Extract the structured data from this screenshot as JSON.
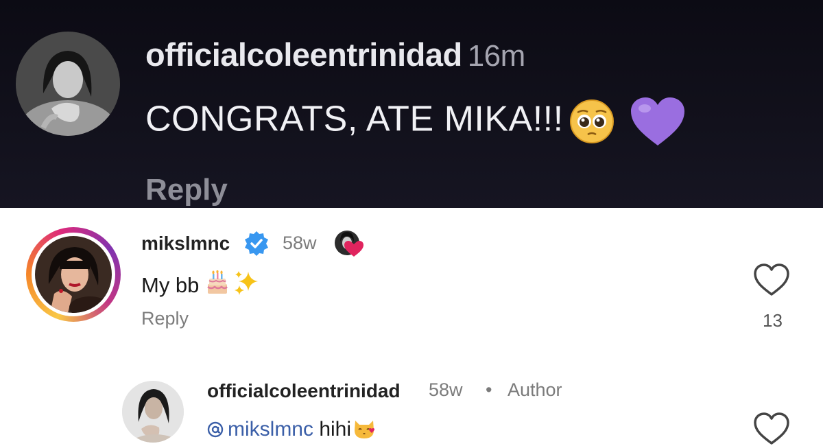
{
  "top_comment": {
    "username": "officialcoleentrinidad",
    "time": "16m",
    "text": "CONGRATS, ATE MIKA!!!",
    "emoji_1": "pleading-face-icon",
    "emoji_2": "purple-heart-icon",
    "reply_label": "Reply"
  },
  "comment": {
    "username": "mikslmnc",
    "verified": true,
    "time": "58w",
    "text": "My bb",
    "emoji_1": "birthday-cake-icon",
    "emoji_2": "sparkles-icon",
    "reply_label": "Reply",
    "like_count": "13",
    "liked_by_creator": true
  },
  "reply": {
    "username": "officialcoleentrinidad",
    "time": "58w",
    "separator": "•",
    "badge": "Author",
    "mention": "mikslmnc",
    "text": " hihi",
    "emoji": "kissing-cat-icon"
  },
  "colors": {
    "dark_bg": "#0c0b14",
    "mention": "#3b5fa8",
    "verified": "#3897f0",
    "liked_heart": "#e0245e"
  }
}
